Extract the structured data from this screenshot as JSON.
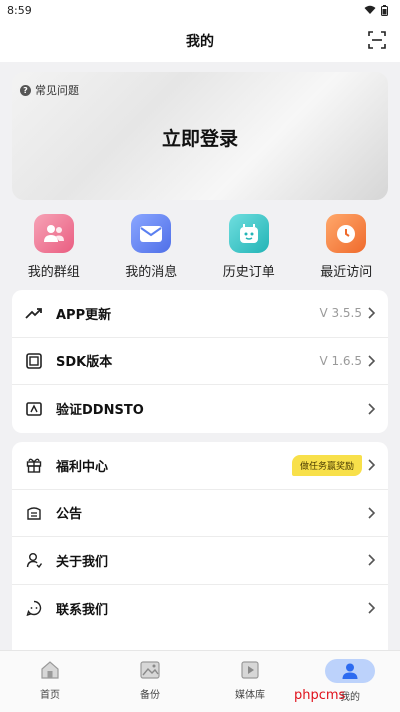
{
  "status": {
    "time": "8:59"
  },
  "header": {
    "title": "我的"
  },
  "login": {
    "faq": "常见问题",
    "title": "立即登录"
  },
  "quick": [
    {
      "label": "我的群组",
      "icon": "group-icon",
      "color": "#ef6a8a"
    },
    {
      "label": "我的消息",
      "icon": "mail-icon",
      "color": "#5a7ff0"
    },
    {
      "label": "历史订单",
      "icon": "order-icon",
      "color": "#35c4c6"
    },
    {
      "label": "最近访问",
      "icon": "clock-icon",
      "color": "#f37a42"
    }
  ],
  "menu1": [
    {
      "label": "APP更新",
      "value": "V 3.5.5",
      "icon": "trend-icon"
    },
    {
      "label": "SDK版本",
      "value": "V 1.6.5",
      "icon": "sdk-icon"
    },
    {
      "label": "验证DDNSTO",
      "value": "",
      "icon": "verify-icon"
    }
  ],
  "menu2": [
    {
      "label": "福利中心",
      "badge": "做任务赢奖励",
      "icon": "gift-icon"
    },
    {
      "label": "公告",
      "icon": "notice-icon"
    },
    {
      "label": "关于我们",
      "icon": "about-icon"
    },
    {
      "label": "联系我们",
      "icon": "contact-icon"
    }
  ],
  "tabs": [
    {
      "label": "首页",
      "icon": "home-icon"
    },
    {
      "label": "备份",
      "icon": "backup-icon"
    },
    {
      "label": "媒体库",
      "icon": "media-icon"
    },
    {
      "label": "我的",
      "icon": "profile-icon",
      "active": true
    }
  ],
  "watermark": "phpcms"
}
